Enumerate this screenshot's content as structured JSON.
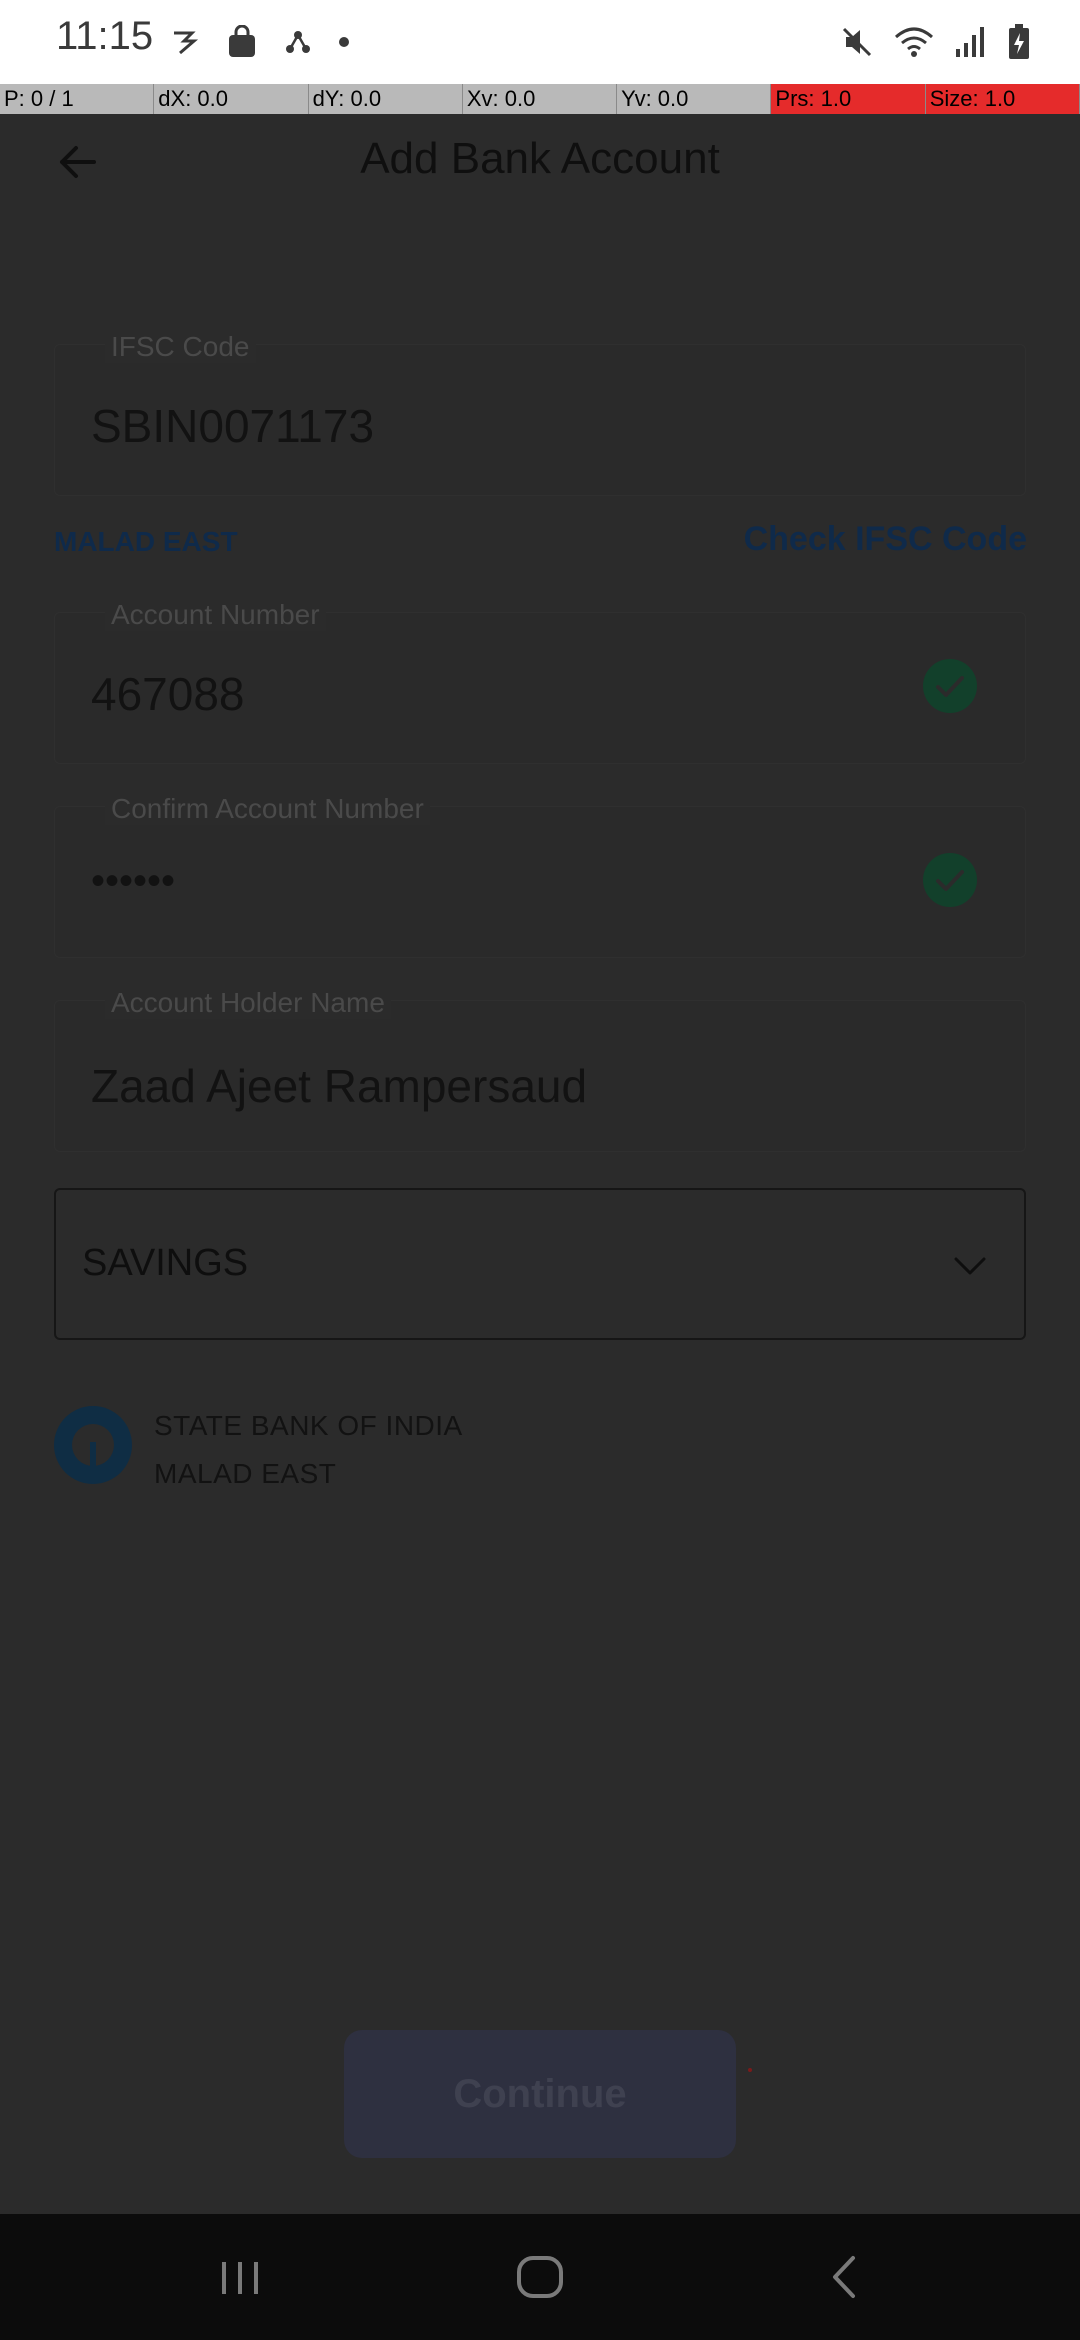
{
  "status_bar": {
    "time": "11:15",
    "left_icons": [
      "rupee-app-icon",
      "shopping-bag-icon",
      "share-nodes-icon",
      "dot-icon"
    ],
    "right_icons": [
      "mute-icon",
      "wifi-icon",
      "signal-icon",
      "battery-charging-icon"
    ]
  },
  "debug_overlay": {
    "pointer": "P: 0 / 1",
    "dx": "dX: 0.0",
    "dy": "dY: 0.0",
    "xv": "Xv: 0.0",
    "yv": "Yv: 0.0",
    "prs": "Prs: 1.0",
    "size": "Size: 1.0"
  },
  "header": {
    "title": "Add Bank Account",
    "back_icon": "arrow-left-icon"
  },
  "form": {
    "ifsc": {
      "label": "IFSC Code",
      "value": "SBIN0071173"
    },
    "ifsc_branch": "MALAD EAST",
    "check_ifsc_label": "Check IFSC Code",
    "account_number": {
      "label": "Account Number",
      "value": "467088",
      "verified": true
    },
    "confirm_account_number": {
      "label": "Confirm Account Number",
      "value": "••••••",
      "verified": true
    },
    "account_holder": {
      "label": "Account Holder Name",
      "value": "Zaad Ajeet Rampersaud"
    },
    "account_type": {
      "value": "SAVINGS"
    }
  },
  "bank_info": {
    "name": "STATE BANK OF INDIA",
    "branch": "MALAD EAST"
  },
  "continue_label": "Continue",
  "colors": {
    "overlay_background": "#2b2b2b",
    "accent_dim": "#0f2a4a",
    "check_green_dim": "#12402b",
    "button_dim": "#2e3040"
  },
  "nav_bar": {
    "icons": [
      "recent-apps-icon",
      "home-icon",
      "back-icon"
    ]
  }
}
